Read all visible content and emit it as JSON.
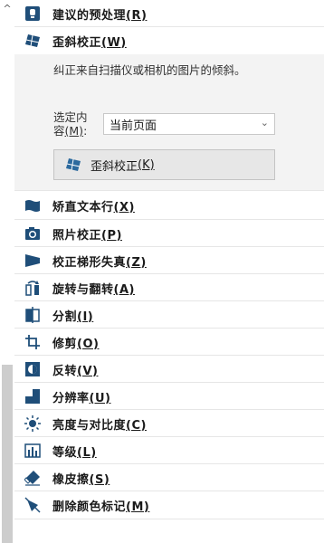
{
  "tools": [
    {
      "label": "建议的预处理",
      "key": "(R)",
      "icon": "suggested-preprocess-icon"
    },
    {
      "label": "歪斜校正",
      "key": "(W)",
      "icon": "deskew-icon"
    },
    {
      "label": "矫直文本行",
      "key": "(X)",
      "icon": "straighten-lines-icon"
    },
    {
      "label": "照片校正",
      "key": "(P)",
      "icon": "camera-icon"
    },
    {
      "label": "校正梯形失真",
      "key": "(Z)",
      "icon": "trapezoid-icon"
    },
    {
      "label": "旋转与翻转",
      "key": "(A)",
      "icon": "rotate-flip-icon"
    },
    {
      "label": "分割",
      "key": "(I)",
      "icon": "split-icon"
    },
    {
      "label": "修剪",
      "key": "(O)",
      "icon": "crop-icon"
    },
    {
      "label": "反转",
      "key": "(V)",
      "icon": "invert-icon"
    },
    {
      "label": "分辨率",
      "key": "(U)",
      "icon": "resolution-icon"
    },
    {
      "label": "亮度与对比度",
      "key": "(C)",
      "icon": "brightness-icon"
    },
    {
      "label": "等级",
      "key": "(L)",
      "icon": "levels-icon"
    },
    {
      "label": "橡皮擦",
      "key": "(S)",
      "icon": "eraser-icon"
    },
    {
      "label": "删除颜色标记",
      "key": "(M)",
      "icon": "remove-color-marks-icon"
    }
  ],
  "deskew_panel": {
    "description": "纠正来自扫描仪或相机的图片的倾斜。",
    "select_label_line1": "选定内",
    "select_label_line2": "容",
    "select_label_key": "(M)",
    "select_label_colon": ":",
    "select_value": "当前页面",
    "button_label": "歪斜校正",
    "button_key": "(K)"
  },
  "colors": {
    "accent": "#1f4e79",
    "panel_bg": "#f3f3f3",
    "scroll_thumb": "#cdcdcd"
  }
}
